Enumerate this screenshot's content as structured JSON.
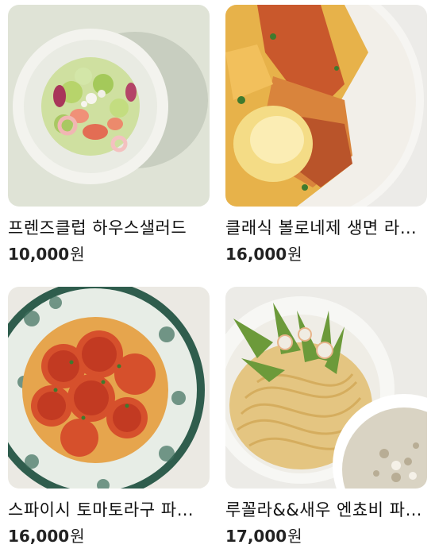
{
  "products": [
    {
      "name": "프렌즈클럽 하우스샐러드",
      "price": "10,000",
      "currency": "원",
      "image": "house-salad-photo"
    },
    {
      "name": "클래식 볼로네제 생면 라자냐",
      "price": "16,000",
      "currency": "원",
      "image": "bolognese-lasagna-photo"
    },
    {
      "name": "스파이시 토마토라구 파스타",
      "price": "16,000",
      "currency": "원",
      "image": "spicy-tomato-ragu-photo"
    },
    {
      "name": "루꼴라&&새우 엔쵸비 파스타",
      "price": "17,000",
      "currency": "원",
      "image": "arugula-shrimp-anchovy-photo"
    }
  ]
}
